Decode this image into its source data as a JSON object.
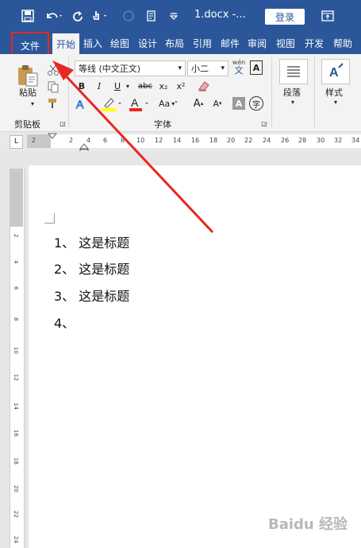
{
  "window": {
    "doc_title": "1.docx  -...",
    "login_label": "登录"
  },
  "tabs": [
    "开始",
    "插入",
    "绘图",
    "设计",
    "布局",
    "引用",
    "邮件",
    "审阅",
    "视图",
    "开发",
    "帮助"
  ],
  "file_tab": "文件",
  "ribbon": {
    "clipboard": {
      "paste_label": "粘贴",
      "group_label": "剪贴板"
    },
    "font": {
      "font_name": "等线 (中文正文)",
      "font_size": "小二",
      "pinyin_top": "wén",
      "pinyin_char": "文",
      "bold": "B",
      "italic": "I",
      "underline": "U",
      "strike": "abc",
      "sub": "x₂",
      "sup": "x²",
      "font_color_letter": "A",
      "grow": "A",
      "shrink": "A",
      "change_case": "Aa",
      "shade_char": "A",
      "encircle_char": "字",
      "group_label": "字体"
    },
    "paragraph": {
      "label": "段落"
    },
    "styles": {
      "label": "样式"
    }
  },
  "ruler": {
    "indicator": "L",
    "ticks": [
      "2",
      "2",
      "4",
      "6",
      "8",
      "10",
      "12",
      "14",
      "16",
      "18",
      "20",
      "22",
      "24",
      "26",
      "28",
      "30",
      "32",
      "34"
    ]
  },
  "vruler": {
    "ticks": [
      "2",
      "4",
      "6",
      "8",
      "10",
      "12",
      "14",
      "16",
      "18",
      "20",
      "22",
      "24"
    ]
  },
  "document": {
    "lines": [
      "1、  这是标题",
      "2、  这是标题",
      "3、  这是标题",
      "4、"
    ]
  },
  "watermark": "Baidu 经验",
  "colors": {
    "accent": "#2b579a",
    "highlight_red": "#e8281f",
    "highlight_yellow": "#ffff00",
    "font_red": "#e8281f"
  }
}
